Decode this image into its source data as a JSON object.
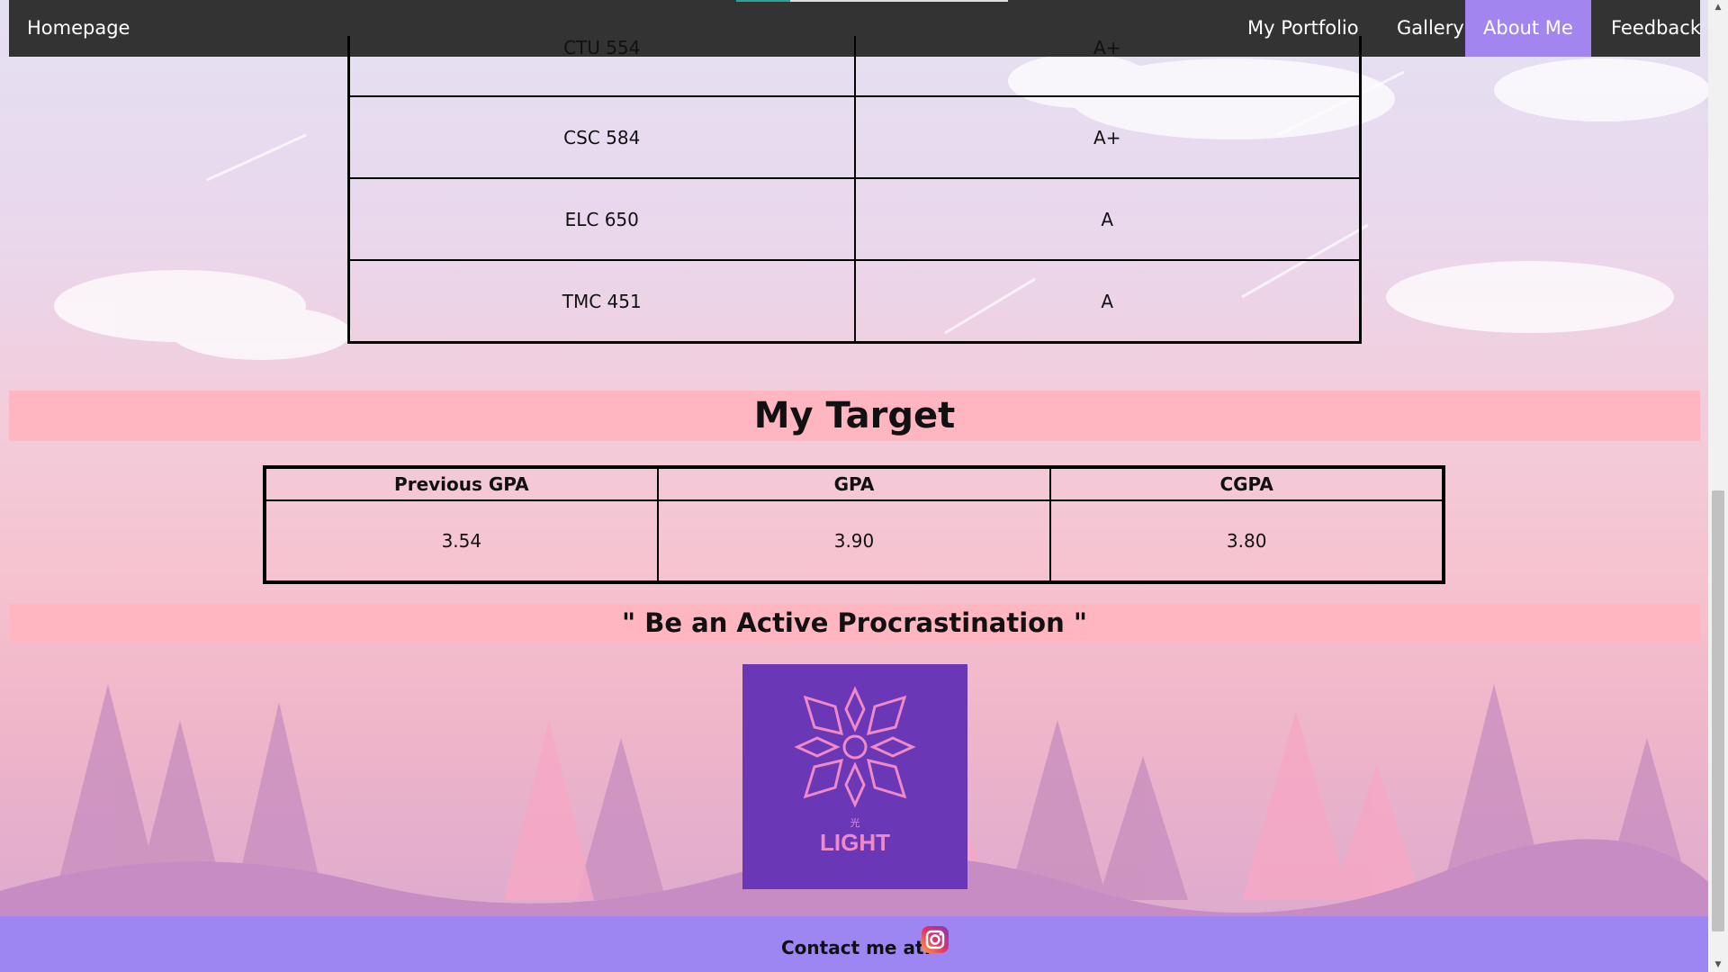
{
  "nav": {
    "home_label": "Homepage",
    "items": [
      {
        "label": "My Portfolio"
      },
      {
        "label": "Gallery"
      },
      {
        "label": "About Me"
      },
      {
        "label": "Feedback"
      }
    ],
    "active_color": "#a385f0"
  },
  "grades": {
    "rows": [
      {
        "subject": "CTU 554",
        "grade": "A+"
      },
      {
        "subject": "CSC 584",
        "grade": "A+"
      },
      {
        "subject": "ELC 650",
        "grade": "A"
      },
      {
        "subject": "TMC 451",
        "grade": "A"
      }
    ]
  },
  "target": {
    "title": "My Target",
    "headers": [
      "Previous GPA",
      "GPA",
      "CGPA"
    ],
    "values": [
      "3.54",
      "3.90",
      "3.80"
    ]
  },
  "quote": "\" Be an Active Procrastination \"",
  "logo": {
    "small_text": "光",
    "text": "LIGHT",
    "bg_color": "#6a38b7",
    "accent_color": "#f089c6"
  },
  "footer": {
    "contact_label": "Contact me at:",
    "icon": "instagram-icon",
    "bg_color": "#9d86f2"
  },
  "colors": {
    "banner": "#ffb6c1",
    "navbar": "#333333"
  }
}
